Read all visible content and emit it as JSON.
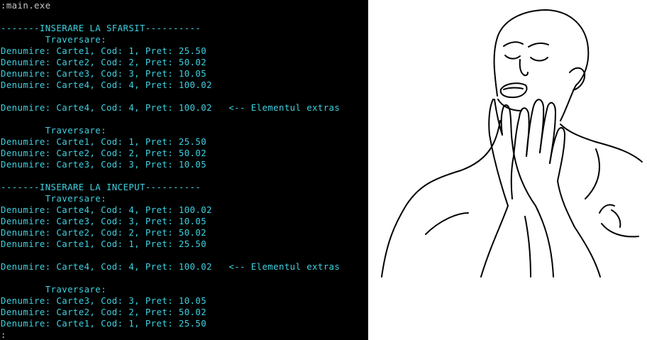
{
  "console": {
    "lines": [
      ":main.exe",
      "",
      "-------INSERARE LA SFARSIT----------",
      "        Traversare:",
      "Denumire: Carte1, Cod: 1, Pret: 25.50",
      "Denumire: Carte2, Cod: 2, Pret: 50.02",
      "Denumire: Carte3, Cod: 3, Pret: 10.05",
      "Denumire: Carte4, Cod: 4, Pret: 100.02",
      "",
      "Denumire: Carte4, Cod: 4, Pret: 100.02   <-- Elementul extras",
      "",
      "        Traversare:",
      "Denumire: Carte1, Cod: 1, Pret: 25.50",
      "Denumire: Carte2, Cod: 2, Pret: 50.02",
      "Denumire: Carte3, Cod: 3, Pret: 10.05",
      "",
      "-------INSERARE LA INCEPUT----------",
      "        Traversare:",
      "Denumire: Carte4, Cod: 4, Pret: 100.02",
      "Denumire: Carte3, Cod: 3, Pret: 10.05",
      "Denumire: Carte2, Cod: 2, Pret: 50.02",
      "Denumire: Carte1, Cod: 1, Pret: 25.50",
      "",
      "Denumire: Carte4, Cod: 4, Pret: 100.02   <-- Elementul extras",
      "",
      "        Traversare:",
      "Denumire: Carte3, Cod: 3, Pret: 10.05",
      "Denumire: Carte2, Cod: 2, Pret: 50.02",
      "Denumire: Carte1, Cod: 1, Pret: 25.50",
      ":"
    ]
  },
  "colors": {
    "console_background": "#000000",
    "console_text": "#3fd0e0",
    "prompt_text": "#c8c8c8",
    "meme_background": "#ffffff"
  },
  "meme": {
    "icon": "satisfied-face-meme-drawing"
  }
}
